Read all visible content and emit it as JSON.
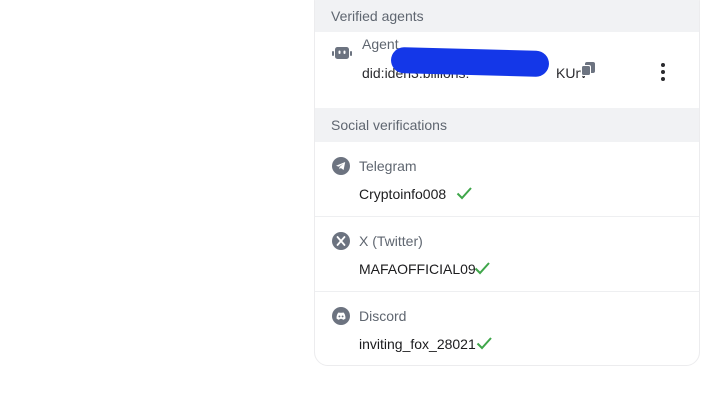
{
  "verified_agents": {
    "header": "Verified agents",
    "agent": {
      "title": "Agent",
      "did_visible_start": "did:iden3:billions:",
      "did_visible_end": "KUrv",
      "icon": "robot-icon"
    }
  },
  "social": {
    "header": "Social verifications",
    "items": [
      {
        "title": "Telegram",
        "value": "Cryptoinfo008",
        "icon": "telegram-icon",
        "verified": true
      },
      {
        "title": "X (Twitter)",
        "value": "MAFAOFFICIAL09",
        "icon": "x-twitter-icon",
        "verified": true
      },
      {
        "title": "Discord",
        "value": "inviting_fox_28021",
        "icon": "discord-icon",
        "verified": true
      }
    ]
  },
  "colors": {
    "check": "#3fa64a",
    "icon_gray": "#6c7380",
    "redaction": "#1437e8"
  }
}
